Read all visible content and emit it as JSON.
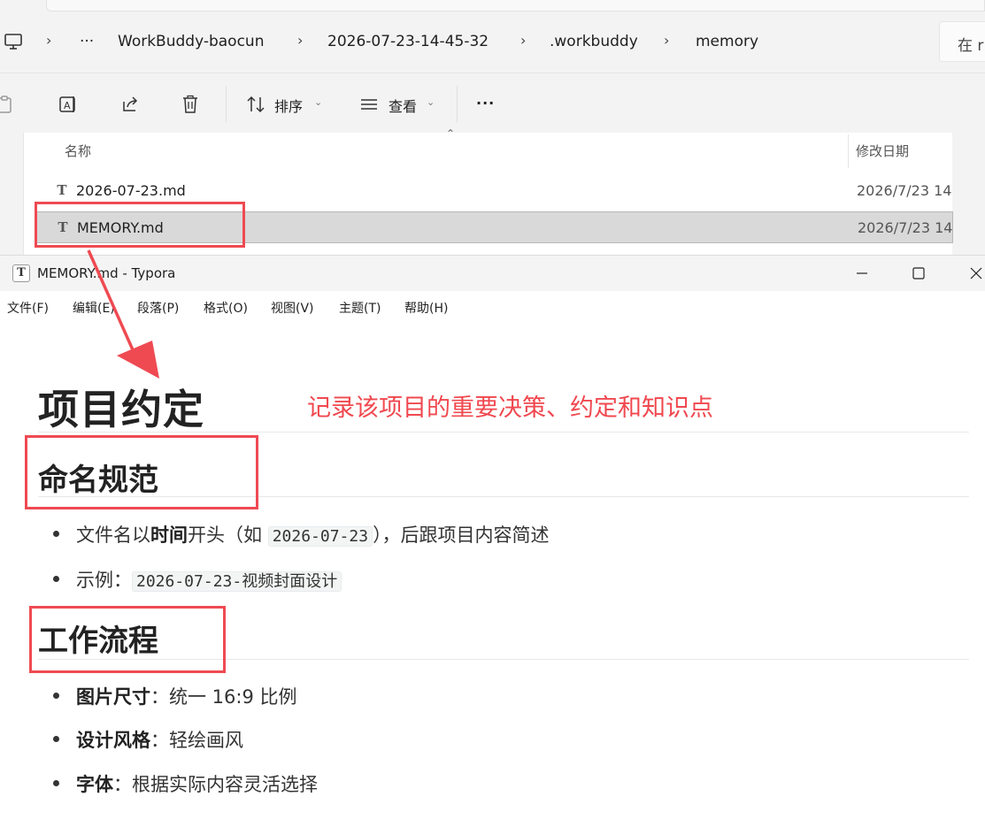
{
  "explorer": {
    "breadcrumb": [
      "WorkBuddy-baocun",
      "2026-07-23-14-45-32",
      ".workbuddy",
      "memory"
    ],
    "more_label": "···",
    "search_placeholder": "在 r",
    "toolbar": {
      "sort_label": "排序",
      "view_label": "查看",
      "more_label": "···"
    },
    "columns": {
      "name": "名称",
      "modified": "修改日期"
    },
    "files": [
      {
        "name": "2026-07-23.md",
        "modified": "2026/7/23 14",
        "selected": false
      },
      {
        "name": "MEMORY.md",
        "modified": "2026/7/23 14",
        "selected": true
      }
    ]
  },
  "typora": {
    "window_title": "MEMORY.md - Typora",
    "menu": [
      "文件(F)",
      "编辑(E)",
      "段落(P)",
      "格式(O)",
      "视图(V)",
      "主题(T)",
      "帮助(H)"
    ],
    "doc": {
      "h1": "项目约定",
      "sections": [
        {
          "heading": "命名规范",
          "items": [
            {
              "pre": "文件名以",
              "bold": "时间",
              "mid": "开头（如 ",
              "code": "2026-07-23",
              "post": "），后跟项目内容简述"
            },
            {
              "pre": "示例：",
              "code": "2026-07-23-视频封面设计"
            }
          ]
        },
        {
          "heading": "工作流程",
          "items": [
            {
              "bold": "图片尺寸",
              "post": "：统一 16:9 比例"
            },
            {
              "bold": "设计风格",
              "post": "：轻绘画风"
            },
            {
              "bold": "字体",
              "post": "：根据实际内容灵活选择"
            }
          ]
        }
      ]
    }
  },
  "annotation": {
    "note": "记录该项目的重要决策、约定和知识点",
    "color": "#f0484f"
  }
}
